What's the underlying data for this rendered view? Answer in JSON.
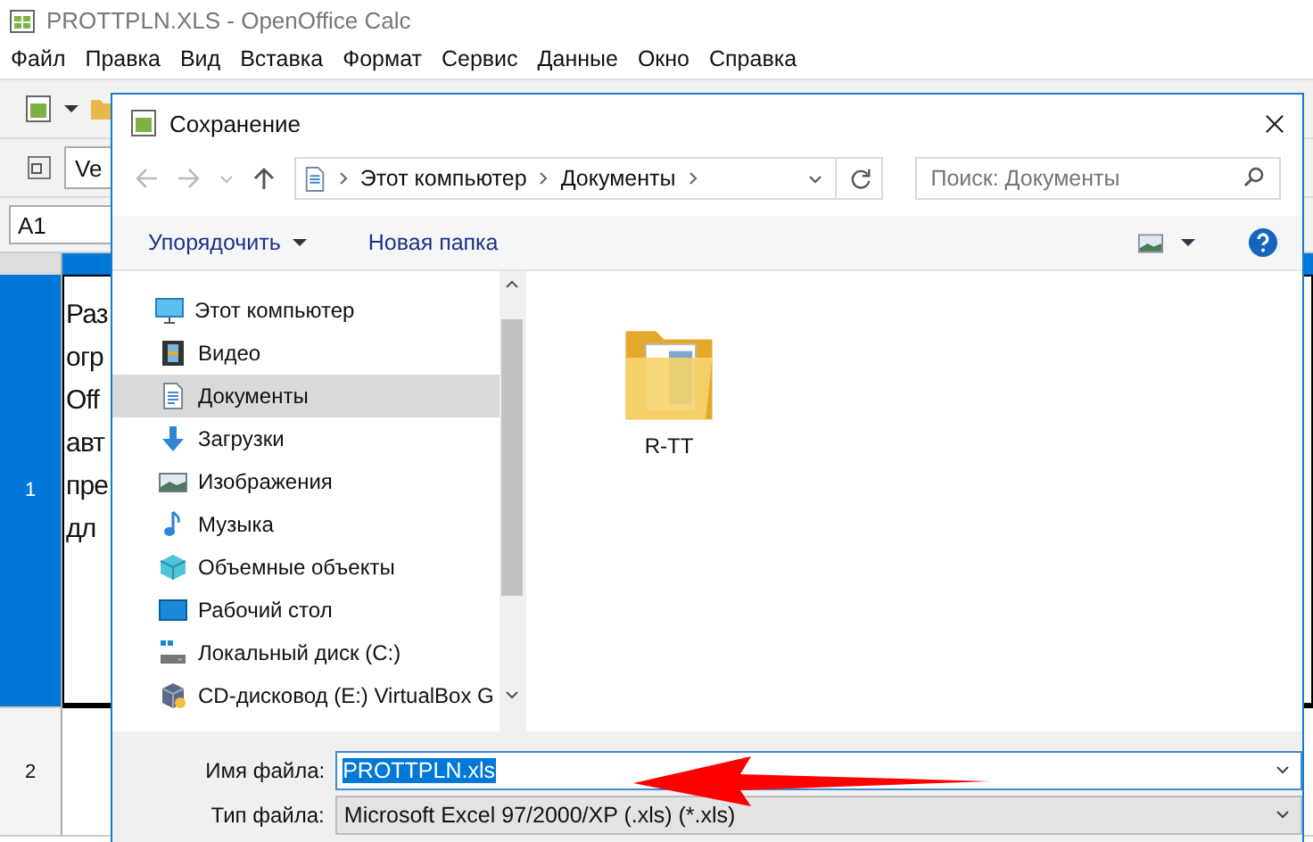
{
  "window": {
    "title": "PROTTPLN.XLS - OpenOffice Calc"
  },
  "menu": [
    "Файл",
    "Правка",
    "Вид",
    "Вставка",
    "Формат",
    "Сервис",
    "Данные",
    "Окно",
    "Справка"
  ],
  "toolbar": {
    "font_field": "Ve"
  },
  "name_box": "A1",
  "sheet": {
    "rows": [
      {
        "header": "1",
        "selected": true,
        "lines": [
          "Раз",
          "огр",
          "Off",
          "авт",
          "пре",
          "дл"
        ]
      },
      {
        "header": "2",
        "selected": false,
        "lines": []
      }
    ]
  },
  "dialog": {
    "title": "Сохранение",
    "breadcrumb": [
      "Этот компьютер",
      "Документы"
    ],
    "search": {
      "placeholder": "Поиск: Документы"
    },
    "commands": [
      {
        "label": "Упорядочить",
        "dropdown": true
      },
      {
        "label": "Новая папка",
        "dropdown": false
      }
    ],
    "nav": [
      {
        "label": "Этот компьютер",
        "kind": "computer",
        "selected": false,
        "children": [
          {
            "label": "Видео",
            "kind": "video",
            "selected": false
          },
          {
            "label": "Документы",
            "kind": "document",
            "selected": true
          },
          {
            "label": "Загрузки",
            "kind": "download",
            "selected": false
          },
          {
            "label": "Изображения",
            "kind": "image",
            "selected": false
          },
          {
            "label": "Музыка",
            "kind": "music",
            "selected": false
          },
          {
            "label": "Объемные объекты",
            "kind": "cube",
            "selected": false
          },
          {
            "label": "Рабочий стол",
            "kind": "desktop",
            "selected": false
          },
          {
            "label": "Локальный диск (C:)",
            "kind": "disk",
            "selected": false
          },
          {
            "label": "CD-дисковод (E:) VirtualBox G",
            "kind": "cd",
            "selected": false
          }
        ]
      }
    ],
    "files": [
      {
        "name": "R-TT"
      }
    ],
    "file_name": {
      "label": "Имя файла:",
      "value": "PROTTPLN.xls",
      "text_selected": true
    },
    "file_type": {
      "label": "Тип файла:",
      "value": "Microsoft Excel 97/2000/XP (.xls) (*.xls)"
    }
  }
}
